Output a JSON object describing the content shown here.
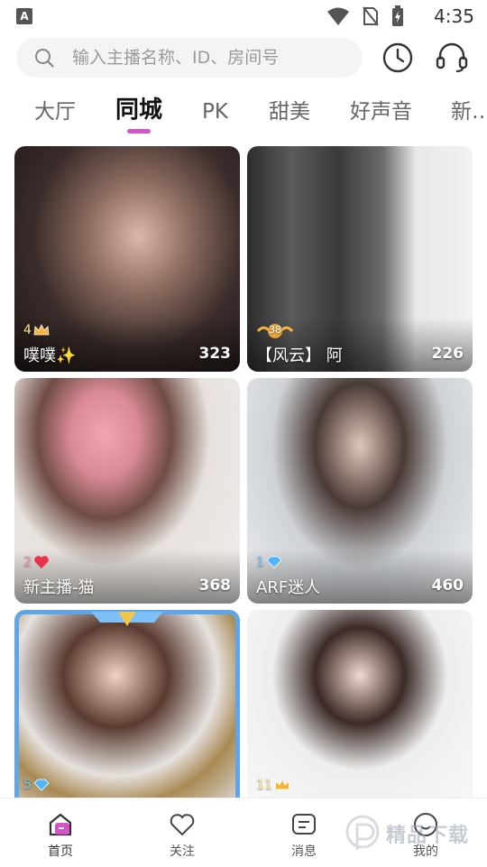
{
  "status_bar": {
    "time": "4:35",
    "app_badge": "A"
  },
  "search": {
    "placeholder": "输入主播名称、ID、房间号"
  },
  "tabs": [
    {
      "label": "大厅",
      "active": false
    },
    {
      "label": "同城",
      "active": true
    },
    {
      "label": "PK",
      "active": false
    },
    {
      "label": "甜美",
      "active": false
    },
    {
      "label": "好声音",
      "active": false
    },
    {
      "label": "新…",
      "active": false
    }
  ],
  "cards": [
    {
      "level": "4",
      "level_icon": "crown-icon",
      "name": "噗噗✨",
      "viewers": "323"
    },
    {
      "level": "38",
      "level_icon": "winged-crown-icon",
      "name": "【风云】 阿",
      "viewers": "226"
    },
    {
      "level": "2",
      "level_icon": "heart-icon",
      "name": "新主播-猫",
      "viewers": "368"
    },
    {
      "level": "1",
      "level_icon": "diamond-icon",
      "name": "ARF迷人",
      "viewers": "460"
    },
    {
      "level": "5",
      "level_icon": "diamond-icon",
      "name": "",
      "viewers": ""
    },
    {
      "level": "11",
      "level_icon": "crown-icon",
      "name": "",
      "viewers": ""
    }
  ],
  "bottom_nav": [
    {
      "label": "首页",
      "icon": "home-icon",
      "active": true
    },
    {
      "label": "关注",
      "icon": "heart-outline-icon",
      "active": false
    },
    {
      "label": "消息",
      "icon": "message-icon",
      "active": false
    },
    {
      "label": "我的",
      "icon": "profile-icon",
      "active": false
    }
  ],
  "watermark": {
    "text": "精品下载"
  },
  "colors": {
    "accent": "#d652c8",
    "search_bg": "#f4f4f6",
    "level_gold": "#ffe58a"
  }
}
